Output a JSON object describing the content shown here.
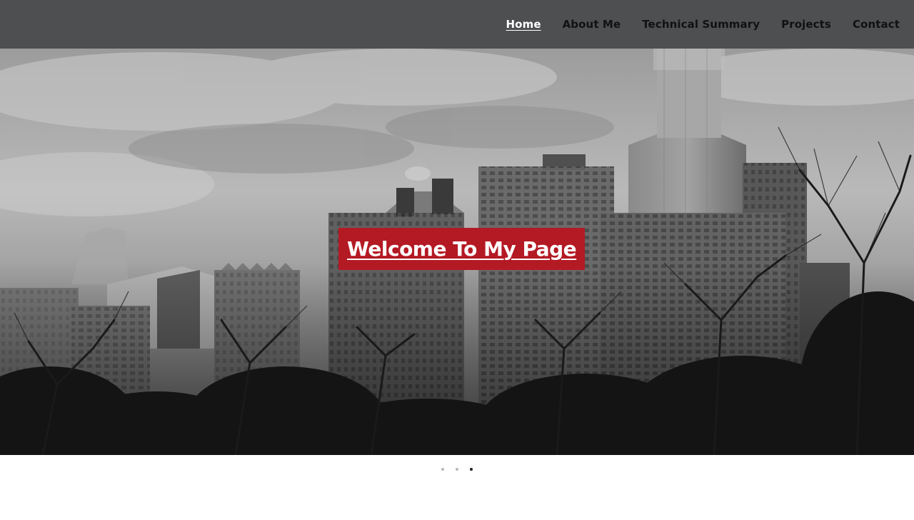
{
  "nav": {
    "items": [
      {
        "label": "Home",
        "active": true
      },
      {
        "label": "About Me",
        "active": false
      },
      {
        "label": "Technical Summary",
        "active": false
      },
      {
        "label": "Projects",
        "active": false
      },
      {
        "label": "Contact",
        "active": false
      }
    ]
  },
  "hero": {
    "welcome_text": "Welcome To My Page",
    "accent_color": "#b41a24",
    "image_subject": "grayscale city skyline with bare trees"
  },
  "carousel": {
    "slide_count": 3,
    "active_index": 2
  },
  "colors": {
    "navbar_bg": "#4e4f51",
    "nav_text": "#111111",
    "nav_active": "#ffffff"
  }
}
